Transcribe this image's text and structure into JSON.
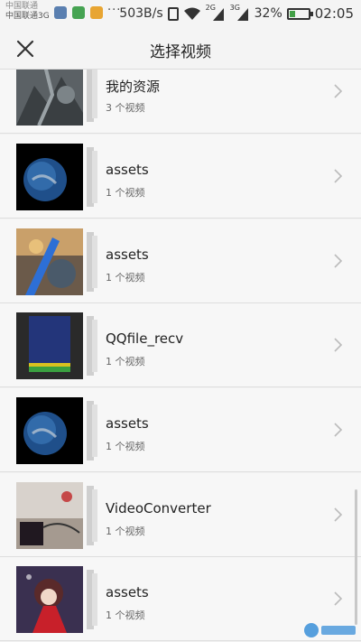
{
  "status_bar": {
    "carrier_line1": "中国联通",
    "carrier_line2": "中国联通3G",
    "net_speed": "503B/s",
    "signal1_label": "2G",
    "signal2_label": "3G",
    "battery_percent": "32%",
    "battery_level": 0.32,
    "time": "02:05"
  },
  "header": {
    "title": "选择视频",
    "close_icon": "close-icon"
  },
  "albums": [
    {
      "name": "我的资源",
      "count": "3 个视频",
      "thumb": "dark-knight"
    },
    {
      "name": "assets",
      "count": "1 个视频",
      "thumb": "earth"
    },
    {
      "name": "assets",
      "count": "1 个视频",
      "thumb": "anime-warrior"
    },
    {
      "name": "QQfile_recv",
      "count": "1 个视频",
      "thumb": "game-screen"
    },
    {
      "name": "assets",
      "count": "1 个视频",
      "thumb": "earth"
    },
    {
      "name": "VideoConverter",
      "count": "1 个视频",
      "thumb": "desk-photo"
    },
    {
      "name": "assets",
      "count": "1 个视频",
      "thumb": "anime-girl"
    }
  ],
  "colors": {
    "background": "#f2f2f2",
    "row_background": "#f7f7f7",
    "divider": "#dedede",
    "battery_fill": "#43a047"
  }
}
